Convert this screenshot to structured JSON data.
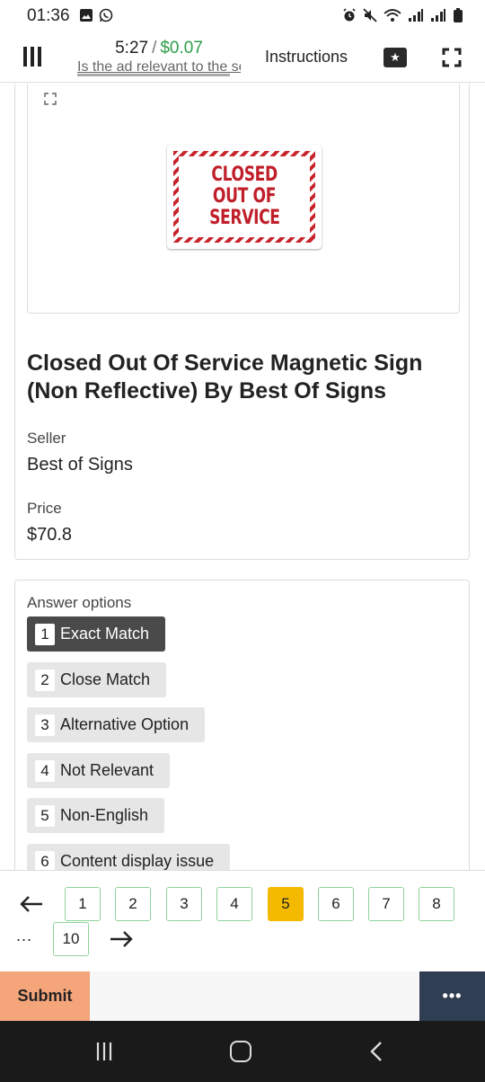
{
  "status_bar": {
    "time": "01:36"
  },
  "header": {
    "timer": "5:27",
    "earnings": "$0.07",
    "task_hint": "Is the ad relevant to the search?",
    "instructions_label": "Instructions"
  },
  "product": {
    "image_text": [
      "CLOSED",
      "OUT OF",
      "SERVICE"
    ],
    "title": "Closed Out Of Service Magnetic Sign (Non Reflective) By Best Of Signs",
    "seller_label": "Seller",
    "seller": "Best of Signs",
    "price_label": "Price",
    "price": "$70.8"
  },
  "answers": {
    "title": "Answer options",
    "options": [
      {
        "key": "1",
        "label": "Exact Match",
        "selected": true
      },
      {
        "key": "2",
        "label": "Close Match",
        "selected": false
      },
      {
        "key": "3",
        "label": "Alternative Option",
        "selected": false
      },
      {
        "key": "4",
        "label": "Not Relevant",
        "selected": false
      },
      {
        "key": "5",
        "label": "Non-English",
        "selected": false
      },
      {
        "key": "6",
        "label": "Content display issue",
        "selected": false
      }
    ]
  },
  "pager": {
    "pages": [
      "1",
      "2",
      "3",
      "4",
      "5",
      "6",
      "7",
      "8",
      "10"
    ],
    "current": "5",
    "ellipsis": "..."
  },
  "actions": {
    "submit_label": "Submit",
    "more_label": "•••"
  },
  "colors": {
    "earnings": "#2e9e4a",
    "current_page": "#f3ba00",
    "page_border": "#8fd49a",
    "submit_bg": "#f5a57a",
    "more_bg": "#2f3e52",
    "selected_option": "#4a4a4a",
    "sign_red": "#c01f2a"
  }
}
